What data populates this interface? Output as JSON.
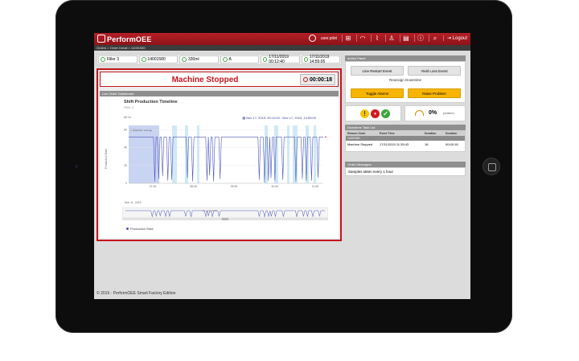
{
  "app": {
    "title": "PerformOEE",
    "user": "user.pilot",
    "logout_label": "Logout"
  },
  "breadcrumb": "Orders > Order Detail > 14001580",
  "info_strip": [
    "Filler 3",
    "14001580",
    "330ml",
    "A",
    "17/11/2019 00:12:40",
    "17/11/2019 14:55:05"
  ],
  "status": {
    "text": "Machine Stopped",
    "timer": "00:00:18"
  },
  "dashboard": {
    "header": "Live Order Dashboard"
  },
  "chart_data": {
    "type": "line",
    "title": "Shift Production Timeline",
    "subtitle": "Filler 3",
    "zoom_label": "All 1h",
    "range_label": "Nov 17, 2019, 00:12:00 - Nov 17, 2019, 14:55:00",
    "ylabel": "Production Rate",
    "ylim": [
      0,
      65
    ],
    "ytick_labels": [
      "0",
      "20",
      "40",
      "60"
    ],
    "xtick_labels": [
      "07:00",
      "08:00",
      "09:00",
      "10:00",
      "11:00"
    ],
    "date_label": "Nov 11, 2019",
    "nav_date": "Nov 11, 2019",
    "legend": "Production Rate",
    "band_label": "1 Machine set-up",
    "series": [
      {
        "name": "Production Rate",
        "values": [
          52,
          52,
          52,
          52,
          52,
          52,
          52,
          52,
          52,
          52,
          52,
          52,
          52,
          52,
          52,
          52,
          52,
          52,
          52,
          52,
          52,
          52,
          52,
          52,
          52,
          52,
          52,
          52,
          52,
          52,
          52,
          52,
          52,
          52,
          52,
          52,
          52,
          52,
          52,
          52,
          52,
          52,
          52,
          52,
          52,
          52,
          52,
          52,
          52,
          52,
          52,
          52,
          52,
          52,
          52,
          52,
          52,
          52,
          52,
          52,
          52,
          52,
          52,
          52,
          52,
          52,
          52,
          52,
          52,
          52,
          52,
          52,
          52,
          52,
          52,
          52,
          52,
          52,
          52,
          52,
          52,
          52,
          52,
          52,
          52,
          52,
          52,
          52,
          52,
          52,
          52,
          52,
          52,
          52,
          52,
          52,
          52,
          52,
          52,
          52,
          52,
          52,
          52,
          52,
          52,
          52,
          52,
          52,
          52,
          52,
          52,
          52,
          52,
          52,
          52,
          52,
          52,
          52,
          52,
          52,
          52,
          52,
          52,
          52,
          52,
          52,
          52,
          52,
          52,
          52,
          52,
          52,
          52,
          52,
          52,
          52,
          52,
          52,
          52,
          52,
          52,
          52,
          52,
          52,
          52,
          52,
          52,
          52,
          52,
          52
        ]
      }
    ]
  },
  "action_panel": {
    "header": "Action Panel",
    "btn_line_restart": "Line Restart Event",
    "btn_yield_loss": "Yield Loss Event",
    "reassign_label": "Reassign Downtime",
    "btn_toggle_alarms": "Toggle Alarms",
    "btn_raise_problem": "Raise Problem"
  },
  "oee": {
    "value": "0%",
    "unit": "(units/m)"
  },
  "downtime": {
    "header": "Downtime Task List",
    "columns": [
      "Reason Code",
      "Event Time",
      "Duration",
      "Duration"
    ],
    "group": "14001580",
    "rows": [
      {
        "reason": "Machine Stopped",
        "time": "17/11/2019 11:39:43",
        "qty": "18",
        "duration": "00:00:18"
      }
    ]
  },
  "messages": {
    "header": "Order Messages",
    "text": "Samples taken every 1 hour"
  },
  "footer": "© 2019 - PerformOEE Smart Factory Edition",
  "colors": {
    "brand_red": "#c4151c",
    "series": "#4a56b8",
    "band": "#cfe9f7",
    "alarm_yellow": "#f7b500"
  }
}
